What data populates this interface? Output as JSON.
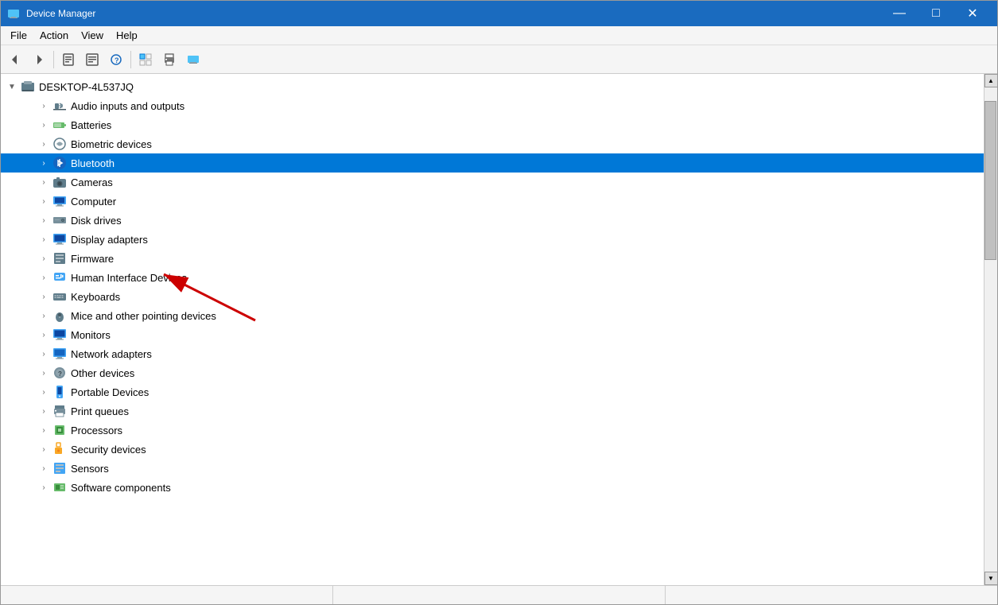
{
  "window": {
    "title": "Device Manager",
    "icon": "computer"
  },
  "titlebar": {
    "minimize_label": "—",
    "maximize_label": "□",
    "close_label": "✕"
  },
  "menu": {
    "items": [
      "File",
      "Action",
      "View",
      "Help"
    ]
  },
  "toolbar": {
    "buttons": [
      {
        "name": "back",
        "symbol": "←"
      },
      {
        "name": "forward",
        "symbol": "→"
      },
      {
        "name": "properties",
        "symbol": "⊞"
      },
      {
        "name": "update-driver",
        "symbol": "≡"
      },
      {
        "name": "help",
        "symbol": "?"
      },
      {
        "name": "show-hidden",
        "symbol": "⊟"
      },
      {
        "name": "print",
        "symbol": "🖨"
      },
      {
        "name": "scan",
        "symbol": "🖥"
      }
    ]
  },
  "tree": {
    "root": {
      "label": "DESKTOP-4L537JQ",
      "expanded": true
    },
    "items": [
      {
        "label": "Audio inputs and outputs",
        "icon": "audio",
        "selected": false
      },
      {
        "label": "Batteries",
        "icon": "battery",
        "selected": false
      },
      {
        "label": "Biometric devices",
        "icon": "biometric",
        "selected": false
      },
      {
        "label": "Bluetooth",
        "icon": "bluetooth",
        "selected": true
      },
      {
        "label": "Cameras",
        "icon": "camera",
        "selected": false
      },
      {
        "label": "Computer",
        "icon": "computer",
        "selected": false
      },
      {
        "label": "Disk drives",
        "icon": "disk",
        "selected": false
      },
      {
        "label": "Display adapters",
        "icon": "display",
        "selected": false
      },
      {
        "label": "Firmware",
        "icon": "firmware",
        "selected": false
      },
      {
        "label": "Human Interface Devices",
        "icon": "hid",
        "selected": false
      },
      {
        "label": "Keyboards",
        "icon": "keyboard",
        "selected": false
      },
      {
        "label": "Mice and other pointing devices",
        "icon": "mouse",
        "selected": false
      },
      {
        "label": "Monitors",
        "icon": "monitor",
        "selected": false
      },
      {
        "label": "Network adapters",
        "icon": "network",
        "selected": false
      },
      {
        "label": "Other devices",
        "icon": "other",
        "selected": false
      },
      {
        "label": "Portable Devices",
        "icon": "portable",
        "selected": false
      },
      {
        "label": "Print queues",
        "icon": "print",
        "selected": false
      },
      {
        "label": "Processors",
        "icon": "processor",
        "selected": false
      },
      {
        "label": "Security devices",
        "icon": "security",
        "selected": false
      },
      {
        "label": "Sensors",
        "icon": "sensors",
        "selected": false
      },
      {
        "label": "Software components",
        "icon": "software",
        "selected": false
      }
    ]
  },
  "status": {
    "sections": [
      "",
      "",
      ""
    ]
  },
  "arrow": {
    "visible": true
  }
}
